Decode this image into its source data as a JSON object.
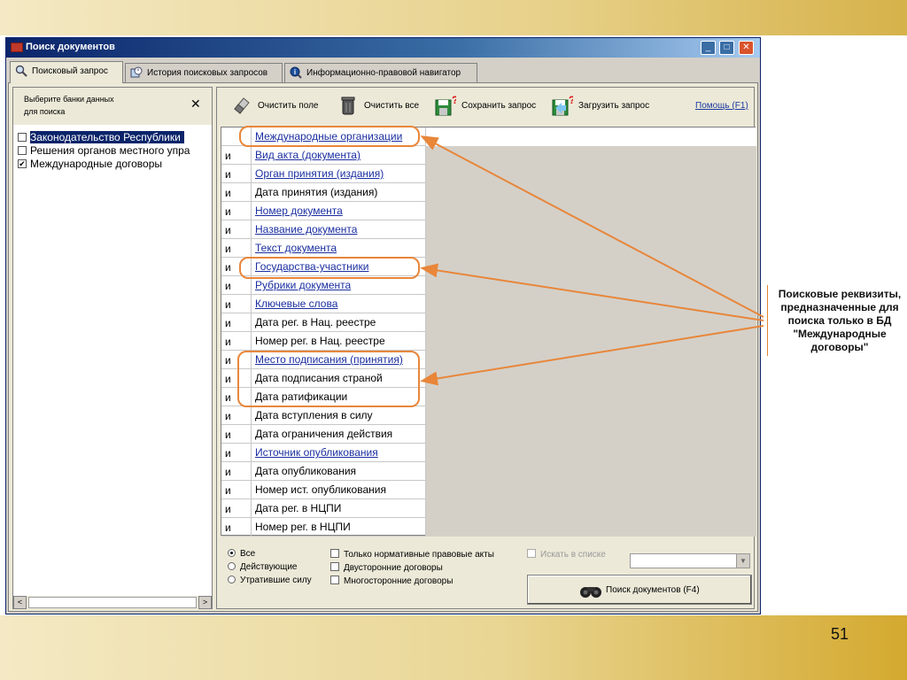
{
  "window": {
    "title": "Поиск документов",
    "controls": {
      "minimize": "_",
      "maximize": "□",
      "close": "✕"
    }
  },
  "tabs": [
    {
      "label": "Поисковый запрос",
      "icon": "magnifier-icon",
      "active": true
    },
    {
      "label": "История поисковых запросов",
      "icon": "history-icon",
      "active": false
    },
    {
      "label": "Информационно-правовой навигатор",
      "icon": "navigator-icon",
      "active": false
    }
  ],
  "databases": {
    "header_line1": "Выберите банки данных",
    "header_line2": "для поиска",
    "close": "✕",
    "items": [
      {
        "label": "Законодательство Республики",
        "checked": false,
        "selected": true
      },
      {
        "label": "Решения органов местного упра",
        "checked": false,
        "selected": false
      },
      {
        "label": "Международные договоры",
        "checked": true,
        "selected": false
      }
    ]
  },
  "toolbar": {
    "clear_field": "Очистить поле",
    "clear_all": "Очистить все",
    "save_query": "Сохранить запрос",
    "load_query": "Загрузить запрос",
    "help": "Помощь (F1)"
  },
  "fields": [
    {
      "op": "",
      "name": "Международные организации",
      "link": true
    },
    {
      "op": "и",
      "name": "Вид акта (документа)",
      "link": true
    },
    {
      "op": "и",
      "name": "Орган принятия (издания)",
      "link": true
    },
    {
      "op": "и",
      "name": "Дата принятия (издания)",
      "link": false
    },
    {
      "op": "и",
      "name": "Номер документа",
      "link": true
    },
    {
      "op": "и",
      "name": "Название документа",
      "link": true
    },
    {
      "op": "и",
      "name": "Текст документа",
      "link": true
    },
    {
      "op": "и",
      "name": "Государства-участники",
      "link": true
    },
    {
      "op": "и",
      "name": "Рубрики документа",
      "link": true
    },
    {
      "op": "и",
      "name": "Ключевые слова",
      "link": true
    },
    {
      "op": "и",
      "name": "Дата рег. в Нац. реестре",
      "link": false
    },
    {
      "op": "и",
      "name": "Номер рег. в Нац. реестре",
      "link": false
    },
    {
      "op": "и",
      "name": "Место подписания (принятия)",
      "link": true
    },
    {
      "op": "и",
      "name": "Дата подписания страной",
      "link": false
    },
    {
      "op": "и",
      "name": "Дата ратификации",
      "link": false
    },
    {
      "op": "и",
      "name": "Дата вступления в силу",
      "link": false
    },
    {
      "op": "и",
      "name": "Дата ограничения действия",
      "link": false
    },
    {
      "op": "и",
      "name": "Источник опубликования",
      "link": true
    },
    {
      "op": "и",
      "name": "Дата опубликования",
      "link": false
    },
    {
      "op": "и",
      "name": "Номер ист. опубликования",
      "link": false
    },
    {
      "op": "и",
      "name": "Дата рег. в НЦПИ",
      "link": false
    },
    {
      "op": "и",
      "name": "Номер рег. в НЦПИ",
      "link": false
    }
  ],
  "filters": {
    "status": [
      {
        "label": "Все",
        "checked": true
      },
      {
        "label": "Действующие",
        "checked": false
      },
      {
        "label": "Утратившие силу",
        "checked": false
      }
    ],
    "types": [
      {
        "label": "Только нормативные правовые акты",
        "checked": false
      },
      {
        "label": "Двусторонние договоры",
        "checked": false
      },
      {
        "label": "Многосторонние договоры",
        "checked": false
      }
    ],
    "search_in_list": "Искать в списке",
    "search_in_list_value": ""
  },
  "search_button": "Поиск документов (F4)",
  "annotation": "Поисковые реквизиты, предназначенные для поиска только в БД \"Международные договоры\"",
  "annotation_color": "#e8863a",
  "slide_number": "51"
}
